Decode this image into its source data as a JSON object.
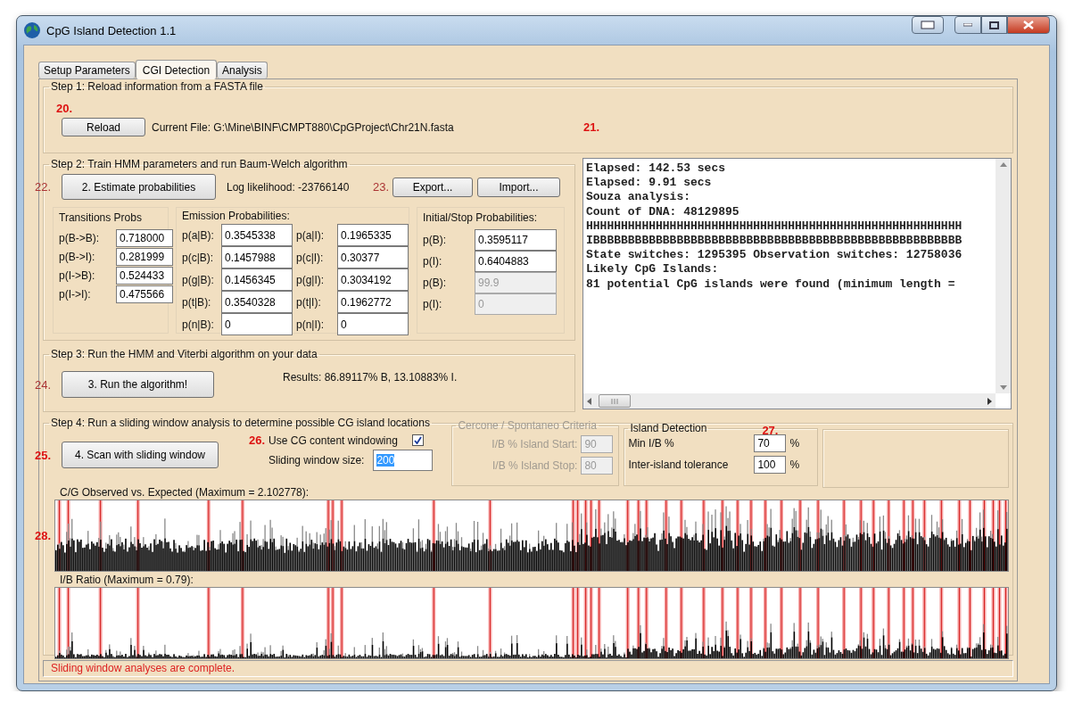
{
  "window": {
    "title": "CpG Island Detection 1.1"
  },
  "tabs": [
    {
      "label": "Setup Parameters",
      "selected": false
    },
    {
      "label": "CGI Detection",
      "selected": true
    },
    {
      "label": "Analysis",
      "selected": false
    }
  ],
  "step1": {
    "legend": "Step 1: Reload information from a FASTA file",
    "marker": "20.",
    "button": "Reload",
    "current_file": "Current File: G:\\Mine\\BINF\\CMPT880\\CpGProject\\Chr21N.fasta"
  },
  "output": {
    "marker": "21.",
    "lines": [
      "Elapsed: 142.53 secs",
      "Elapsed: 9.91 secs",
      "Souza analysis:",
      "Count of DNA: 48129895",
      "HHHHHHHHHHHHHHHHHHHHHHHHHHHHHHHHHHHHHHHHHHHHHHHHHHHHHH",
      "IBBBBBBBBBBBBBBBBBBBBBBBBBBBBBBBBBBBBBBBBBBBBBBBBBBBBB",
      "State switches: 1295395 Observation switches: 12758036",
      "Likely CpG Islands:",
      "81 potential CpG islands were found (minimum length ="
    ]
  },
  "step2": {
    "legend": "Step 2: Train HMM parameters and run Baum-Welch algorithm",
    "marker": "22.",
    "button": "2. Estimate probabilities",
    "log_likelihood": "Log likelihood: -23766140",
    "export_marker": "23.",
    "export_button": "Export...",
    "import_button": "Import...",
    "transitions": {
      "title": "Transitions Probs",
      "fields": [
        {
          "label": "p(B->B):",
          "value": "0.718000"
        },
        {
          "label": "p(B->I):",
          "value": "0.281999"
        },
        {
          "label": "p(I->B):",
          "value": "0.524433"
        },
        {
          "label": "p(I->I):",
          "value": "0.475566"
        }
      ]
    },
    "emission": {
      "title": "Emission Probabilities:",
      "rows": [
        [
          {
            "label": "p(a|B):",
            "value": "0.3545338"
          },
          {
            "label": "p(a|I):",
            "value": "0.1965335"
          }
        ],
        [
          {
            "label": "p(c|B):",
            "value": "0.1457988"
          },
          {
            "label": "p(c|I):",
            "value": "0.30377"
          }
        ],
        [
          {
            "label": "p(g|B):",
            "value": "0.1456345"
          },
          {
            "label": "p(g|I):",
            "value": "0.3034192"
          }
        ],
        [
          {
            "label": "p(t|B):",
            "value": "0.3540328"
          },
          {
            "label": "p(t|I):",
            "value": "0.1962772"
          }
        ],
        [
          {
            "label": "p(n|B):",
            "value": "0"
          },
          {
            "label": "p(n|I):",
            "value": "0"
          }
        ]
      ]
    },
    "initial_stop": {
      "title": "Initial/Stop Probabilities:",
      "fields": [
        {
          "label": "p(B):",
          "value": "0.3595117",
          "disabled": false
        },
        {
          "label": "p(I):",
          "value": "0.6404883",
          "disabled": false
        },
        {
          "label": "p(B):",
          "value": "99.9",
          "disabled": true
        },
        {
          "label": "p(I):",
          "value": "0",
          "disabled": true
        }
      ]
    }
  },
  "step3": {
    "legend": "Step 3: Run the HMM and Viterbi algorithm on your data",
    "marker": "24.",
    "button": "3. Run the algorithm!",
    "results": "Results: 86.89117% B, 13.10883% I."
  },
  "step4": {
    "legend": "Step 4: Run a sliding window analysis to determine possible CG island locations",
    "marker": "25.",
    "button": "4. Scan with sliding window",
    "option_marker": "26.",
    "cg_windowing": {
      "label": "Use CG content windowing",
      "checked": true
    },
    "window_size": {
      "label": "Sliding window size:",
      "value": "200",
      "highlighted": true
    },
    "cercone": {
      "title": "Cercone / Spontaneo Criteria",
      "disabled": true,
      "fields": [
        {
          "label": "I/B % Island Start:",
          "value": "90"
        },
        {
          "label": "I/B % Island Stop:",
          "value": "80"
        }
      ]
    },
    "island": {
      "title": "Island Detection",
      "marker": "27.",
      "fields": [
        {
          "label": "Min I/B %",
          "value": "70",
          "unit": "%"
        },
        {
          "label": "Inter-island tolerance",
          "value": "100",
          "unit": "%"
        }
      ]
    },
    "chart_marker": "28.",
    "charts": [
      {
        "title": "C/G Observed vs. Expected (Maximum = 2.102778):",
        "kind": "dense"
      },
      {
        "title": "I/B Ratio (Maximum = 0.79):",
        "kind": "sparse"
      }
    ]
  },
  "status": "Sliding window analyses are complete."
}
